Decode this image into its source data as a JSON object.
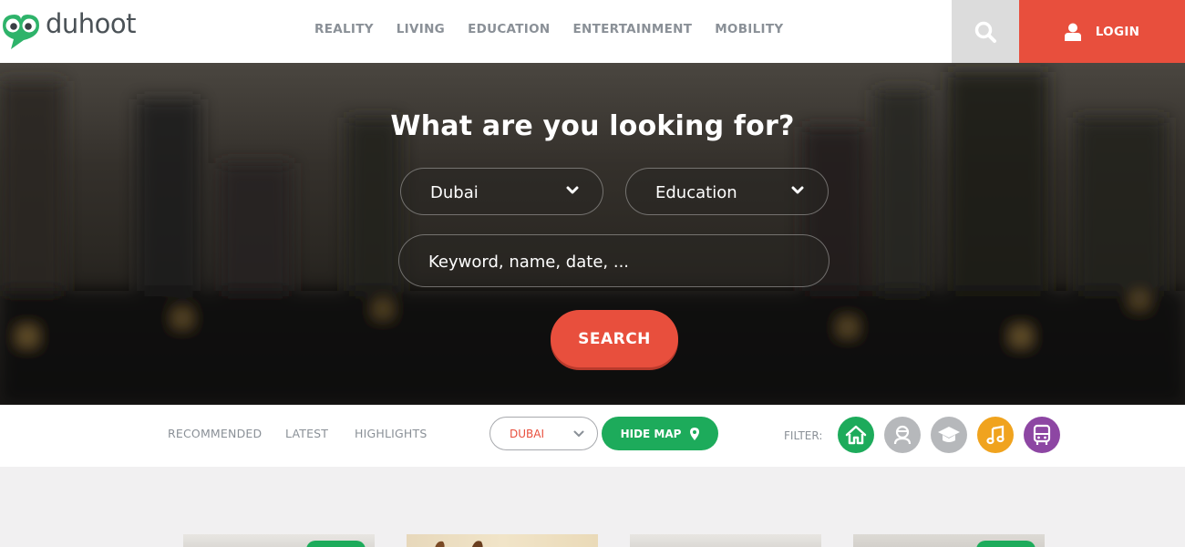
{
  "brand": {
    "name": "duhoot"
  },
  "nav": {
    "items": [
      "REALITY",
      "LIVING",
      "EDUCATION",
      "ENTERTAINMENT",
      "MOBILITY"
    ]
  },
  "header": {
    "search_icon": "search-icon",
    "login_label": "LOGIN",
    "login_icon": "user-icon"
  },
  "hero": {
    "title": "What are you looking for?",
    "location_select": "Dubai",
    "category_select": "Education",
    "keyword_placeholder": "Keyword, name, date, ...",
    "search_button": "SEARCH"
  },
  "filterbar": {
    "tabs": [
      "RECOMMENDED",
      "LATEST",
      "HIGHLIGHTS"
    ],
    "city_select": "DUBAI",
    "hide_map_label": "HIDE MAP",
    "filter_label": "FILTER:",
    "filters": [
      {
        "icon": "home-icon",
        "color": "#1dab5b"
      },
      {
        "icon": "driver-icon",
        "color": "#b6b8bb"
      },
      {
        "icon": "graduation-cap-icon",
        "color": "#b6b8bb"
      },
      {
        "icon": "music-note-icon",
        "color": "#f0a31e"
      },
      {
        "icon": "bus-icon",
        "color": "#8d46a3"
      }
    ]
  },
  "colors": {
    "accent": "#e84f3d",
    "green": "#1dab5b",
    "nav_text": "#8a9097",
    "orange": "#f0a31e",
    "purple": "#8d46a3"
  }
}
